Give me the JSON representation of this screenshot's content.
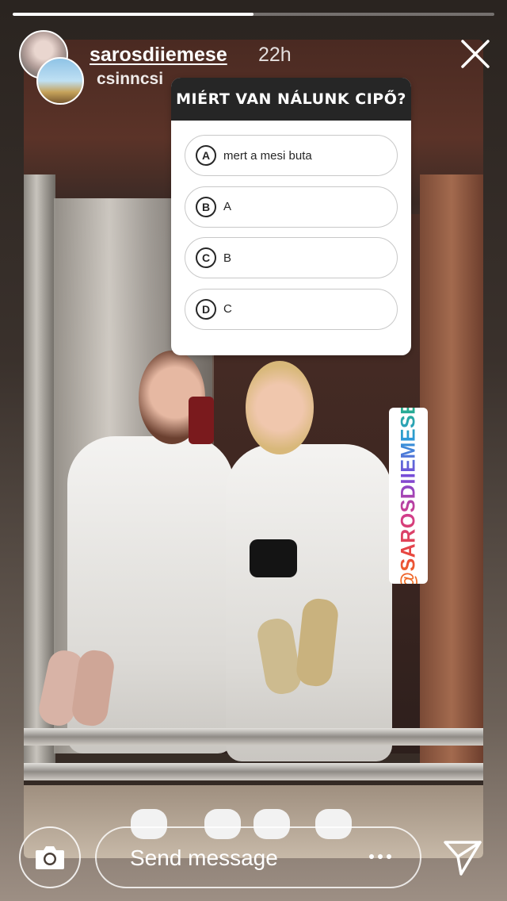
{
  "story": {
    "progress": 0.5,
    "username": "sarosdiiemese",
    "timestamp": "22h",
    "tagged_user": "csinncsi"
  },
  "quiz": {
    "question": "MIÉRT VAN NÁLUNK CIPŐ?",
    "options": [
      {
        "letter": "A",
        "text": "mert a mesi buta"
      },
      {
        "letter": "B",
        "text": "A"
      },
      {
        "letter": "C",
        "text": "B"
      },
      {
        "letter": "D",
        "text": "C"
      }
    ]
  },
  "mention_sticker": {
    "text": "@SAROSDIIEMESE"
  },
  "bottom_bar": {
    "send_placeholder": "Send message"
  },
  "icons": {
    "close": "close-icon",
    "camera": "camera-icon",
    "more": "more-icon",
    "share": "paper-plane-icon"
  }
}
